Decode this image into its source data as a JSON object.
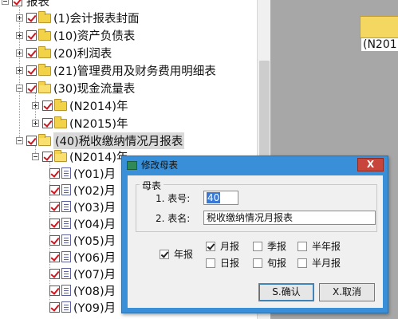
{
  "tree": {
    "root_label": "报表",
    "items": [
      {
        "label": "(1)会计报表封面",
        "level": 1,
        "expander": "plus",
        "icon": "folder"
      },
      {
        "label": "(10)资产负债表",
        "level": 1,
        "expander": "plus",
        "icon": "folder"
      },
      {
        "label": "(20)利润表",
        "level": 1,
        "expander": "plus",
        "icon": "folder"
      },
      {
        "label": "(21)管理费用及财务费用明细表",
        "level": 1,
        "expander": "plus",
        "icon": "folder"
      },
      {
        "label": "(30)现金流量表",
        "level": 1,
        "expander": "minus",
        "icon": "folder"
      },
      {
        "label": "(N2014)年",
        "level": 2,
        "expander": "plus",
        "icon": "folder"
      },
      {
        "label": "(N2015)年",
        "level": 2,
        "expander": "plus",
        "icon": "folder"
      },
      {
        "label": "(40)税收缴纳情况月报表",
        "level": 1,
        "expander": "minus",
        "icon": "folder",
        "selected": true
      },
      {
        "label": "(N2014)年",
        "level": 2,
        "expander": "minus",
        "icon": "folder-open"
      },
      {
        "label": "(Y01)月",
        "level": 3,
        "icon": "document"
      },
      {
        "label": "(Y02)月",
        "level": 3,
        "icon": "document"
      },
      {
        "label": "(Y03)月",
        "level": 3,
        "icon": "document"
      },
      {
        "label": "(Y04)月",
        "level": 3,
        "icon": "document"
      },
      {
        "label": "(Y05)月",
        "level": 3,
        "icon": "document"
      },
      {
        "label": "(Y06)月",
        "level": 3,
        "icon": "document"
      },
      {
        "label": "(Y07)月",
        "level": 3,
        "icon": "document"
      },
      {
        "label": "(Y08)月",
        "level": 3,
        "icon": "document"
      },
      {
        "label": "(Y09)月",
        "level": 3,
        "icon": "document"
      }
    ]
  },
  "right_pane": {
    "folder_caption": "(N201"
  },
  "dialog": {
    "title": "修改母表",
    "close_label": "X",
    "group_label": "母表",
    "field_no_label": "1. 表号:",
    "field_no_value": "40",
    "field_name_label": "2. 表名:",
    "field_name_value": "税收缴纳情况月报表",
    "checkboxes": [
      {
        "label": "年报",
        "checked": true
      },
      {
        "label": "月报",
        "checked": true
      },
      {
        "label": "季报",
        "checked": false
      },
      {
        "label": "半年报",
        "checked": false
      },
      {
        "label": "日报",
        "checked": false
      },
      {
        "label": "旬报",
        "checked": false
      },
      {
        "label": "半月报",
        "checked": false
      }
    ],
    "ok_label": "S.确认",
    "cancel_label": "X.取消"
  },
  "colors": {
    "dialog_frame": "#3a90d8",
    "check_mark": "#d2141e",
    "folder": "#f2d348",
    "close_button": "#c7453a",
    "right_pane": "#a7a7a7"
  }
}
